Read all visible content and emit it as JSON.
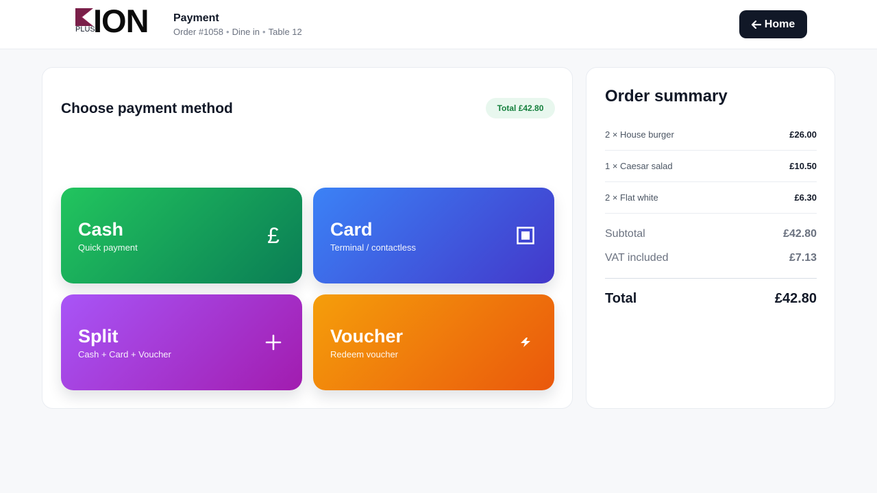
{
  "header": {
    "logo": {
      "plus": "PLUS",
      "wordmark": "ION",
      "accent_color": "#9b2c5f"
    },
    "title": "Payment",
    "order": "Order #1058",
    "mode": "Dine in",
    "table": "Table 12",
    "separator": "•",
    "home_label": "Home",
    "home_icon": "arrow-left-icon"
  },
  "payment": {
    "title": "Choose payment method",
    "total_chip": "Total £42.80",
    "methods": [
      {
        "title": "Cash",
        "subtitle": "Quick payment",
        "icon": "£",
        "icon_name": "pound-icon",
        "colors": [
          "#22c55e",
          "#0a7d55"
        ]
      },
      {
        "title": "Card",
        "subtitle": "Terminal / contactless",
        "icon": "▣",
        "icon_name": "card-terminal-icon",
        "colors": [
          "#3b82f6",
          "#4338ca"
        ]
      },
      {
        "title": "Split",
        "subtitle": "Cash + Card + Voucher",
        "icon": "+",
        "icon_name": "plus-icon",
        "colors": [
          "#a855f7",
          "#a21caf"
        ]
      },
      {
        "title": "Voucher",
        "subtitle": "Redeem voucher",
        "icon": "⚡",
        "icon_name": "lightning-icon",
        "colors": [
          "#f59e0b",
          "#ea580c"
        ]
      }
    ]
  },
  "summary": {
    "title": "Order summary",
    "items": [
      {
        "name": "2 × House burger",
        "amount": "£26.00"
      },
      {
        "name": "1 × Caesar salad",
        "amount": "£10.50"
      },
      {
        "name": "2 × Flat white",
        "amount": "£6.30"
      }
    ],
    "subtotal_label": "Subtotal",
    "subtotal": "£42.80",
    "vat_label": "VAT included",
    "vat": "£7.13",
    "total_label": "Total",
    "total": "£42.80"
  }
}
